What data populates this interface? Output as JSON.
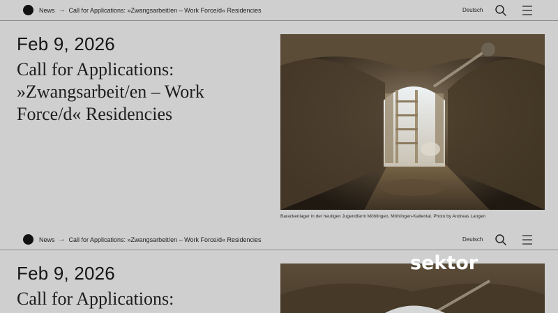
{
  "header": {
    "breadcrumb_news": "News",
    "breadcrumb_arrow": "→",
    "breadcrumb_current": "Call for Applications: »Zwangsarbeit/en – Work Force/d« Residencies",
    "language": "Deutsch"
  },
  "article": {
    "date": "Feb 9, 2026",
    "title_line1": "Call for Applications:",
    "title_line2": "»Zwangsarbeit/en – Work",
    "title_line3": "Force/d« Residencies",
    "image_caption": "Barackenlager in der heutigen Jugendfarm Möhlingen, Möhlingen-Kaltental. Photo by Andreas Langen",
    "image_subject": "tunnel-photo"
  },
  "watermark": {
    "text": "sektor"
  },
  "icons": {
    "logo": "circle-logo-icon",
    "search": "search-icon",
    "menu": "hamburger-menu-icon"
  },
  "colors": {
    "background": "#cfcfcf",
    "text": "#1a1a1a",
    "divider": "#8b8b8b"
  }
}
